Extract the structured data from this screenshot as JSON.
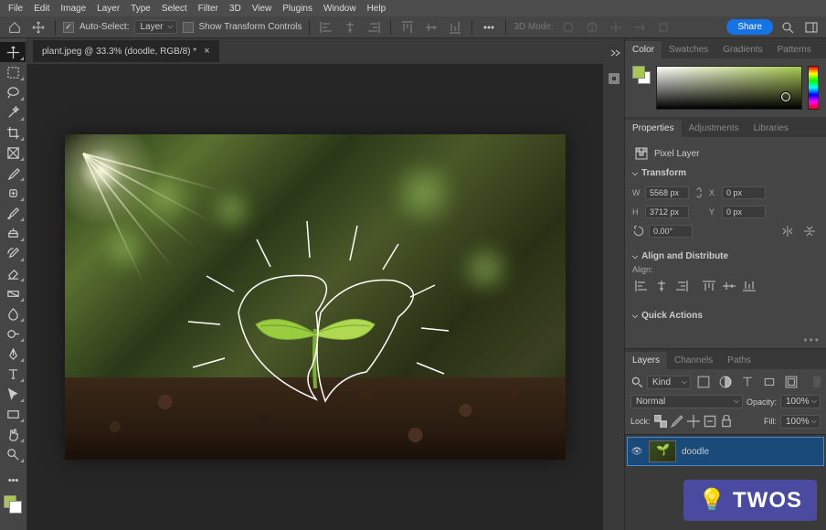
{
  "menubar": [
    "File",
    "Edit",
    "Image",
    "Layer",
    "Type",
    "Select",
    "Filter",
    "3D",
    "View",
    "Plugins",
    "Window",
    "Help"
  ],
  "optbar": {
    "auto_select": "Auto-Select:",
    "autoselect_mode": "Layer",
    "show_transform": "Show Transform Controls",
    "mode_3d": "3D Mode:",
    "share": "Share"
  },
  "doctab": {
    "title": "plant.jpeg @ 33.3% (doodle, RGB/8) *"
  },
  "panels": {
    "color_tabs": [
      "Color",
      "Swatches",
      "Gradients",
      "Patterns"
    ],
    "prop_tabs": [
      "Properties",
      "Adjustments",
      "Libraries"
    ],
    "layer_tabs": [
      "Layers",
      "Channels",
      "Paths"
    ]
  },
  "properties": {
    "type": "Pixel Layer",
    "sections": {
      "transform": {
        "title": "Transform",
        "w": "5568 px",
        "h": "3712 px",
        "x": "0 px",
        "y": "0 px",
        "angle": "0.00°"
      },
      "align": {
        "title": "Align and Distribute",
        "label": "Align:"
      },
      "quick": {
        "title": "Quick Actions"
      }
    }
  },
  "layers": {
    "kind": "Kind",
    "blend": "Normal",
    "opacity_label": "Opacity:",
    "opacity": "100%",
    "lock_label": "Lock:",
    "fill_label": "Fill:",
    "fill": "100%",
    "items": [
      {
        "name": "doodle",
        "visible": true
      }
    ]
  },
  "watermark": "TWOS"
}
